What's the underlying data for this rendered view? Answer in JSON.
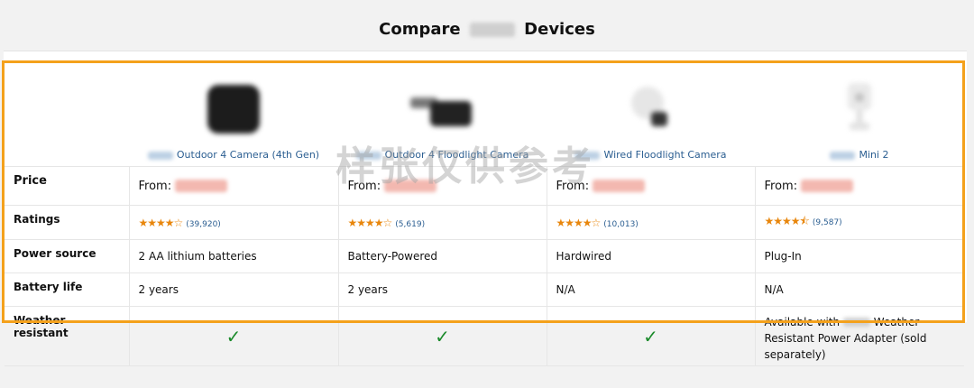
{
  "page": {
    "title_pre": "Compare",
    "title_post": "Devices"
  },
  "products": [
    {
      "name": "Outdoor 4 Camera (4th Gen)",
      "price_prefix": "From:",
      "rating_count": "(39,920)",
      "stars": "★★★★☆",
      "power": "2 AA lithium batteries",
      "battery": "2 years",
      "weather": "check"
    },
    {
      "name": "Outdoor 4 Floodlight Camera",
      "price_prefix": "From:",
      "rating_count": "(5,619)",
      "stars": "★★★★☆",
      "power": "Battery-Powered",
      "battery": "2 years",
      "weather": "check"
    },
    {
      "name": "Wired Floodlight Camera",
      "price_prefix": "From:",
      "rating_count": "(10,013)",
      "stars": "★★★★☆",
      "power": "Hardwired",
      "battery": "N/A",
      "weather": "check"
    },
    {
      "name": "Mini 2",
      "price_prefix": "From:",
      "rating_count": "(9,587)",
      "stars": "★★★★⯪",
      "power": "Plug-In",
      "battery": "N/A",
      "weather_note_pre": "Available with",
      "weather_note_post": "Weather Resistant Power Adapter (sold separately)"
    }
  ],
  "labels": {
    "price": "Price",
    "ratings": "Ratings",
    "power": "Power source",
    "battery": "Battery life",
    "weather": "Weather resistant"
  },
  "checkmark": "✓",
  "watermark": "样张仅供参考",
  "colors": {
    "accent": "#f4a11c",
    "link": "#2b5e91",
    "star": "#e8860c",
    "check": "#1a8a2a"
  }
}
